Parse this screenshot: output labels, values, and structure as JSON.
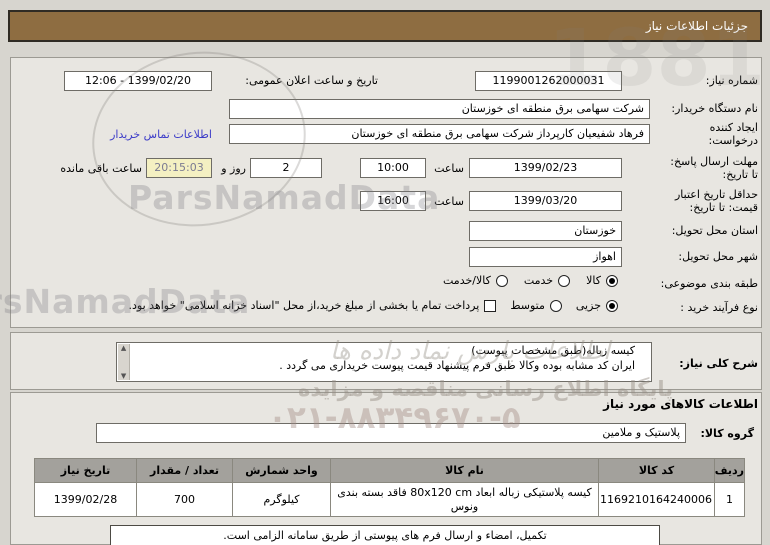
{
  "title_bar": {
    "title": "جزئیات اطلاعات نیاز"
  },
  "colors": {
    "title_bar_bg": "#8e6d41",
    "link": "#3c3cc8",
    "countdown_bg": "#f4f0c2",
    "table_header_bg": "#a3a19c"
  },
  "need_info": {
    "need_number_label": "شماره نیاز:",
    "need_number": "1199001262000031",
    "announce_label": "تاریخ و ساعت اعلان عمومی:",
    "announce_value": "1399/02/20 - 12:06",
    "buyer_label": "نام دستگاه خریدار:",
    "buyer_value": "شرکت سهامی برق منطقه ای خوزستان",
    "creator_label_line1": "ایجاد کننده",
    "creator_label_line2": "درخواست:",
    "creator_value": "فرهاد شفیعیان کارپرداز شرکت سهامی برق منطقه ای خوزستان",
    "contact_link": "اطلاعات تماس خریدار",
    "reply_deadline_label_line1": "مهلت ارسال پاسخ:",
    "reply_deadline_label_line2": "تا تاریخ:",
    "reply_deadline_date": "1399/02/23",
    "hour_label": "ساعت",
    "reply_deadline_time": "10:00",
    "remaining_days": "2",
    "days_and_label": "روز و",
    "remaining_time": "20:15:03",
    "remaining_suffix": "ساعت باقی مانده",
    "price_validity_label_line1": "حداقل تاریخ اعتبار",
    "price_validity_label_line2": "قیمت: تا تاریخ:",
    "price_validity_date": "1399/03/20",
    "price_validity_time": "16:00",
    "province_label": "استان محل تحویل:",
    "province_value": "خوزستان",
    "city_label": "شهر محل تحویل:",
    "city_value": "اهواز",
    "classification_label": "طبقه بندی موضوعی:",
    "classification_options": [
      {
        "label": "کالا",
        "selected": true
      },
      {
        "label": "خدمت",
        "selected": false
      },
      {
        "label": "کالا/خدمت",
        "selected": false
      }
    ],
    "process_label": "نوع فرآیند خرید :",
    "process_options": [
      {
        "label": "جزیی",
        "selected": true
      },
      {
        "label": "متوسط",
        "selected": false
      }
    ],
    "payment_checkbox_label": "پرداخت تمام یا بخشی از مبلغ خرید،از محل \"اسناد خزانه اسلامی\" خواهد بود.",
    "payment_checkbox_checked": false
  },
  "need_description": {
    "label": "شرح کلی نیاز:",
    "line1": "کیسه زباله(طبق مشخصات پیوست)",
    "line2": "ایران کد مشابه بوده وکالا طبق فرم پیشنهاد قیمت پیوست خریداری می گردد ."
  },
  "goods_section": {
    "header": "اطلاعات کالاهای مورد نیاز",
    "group_label": "گروه کالا:",
    "group_value": "پلاستیک و ملامین",
    "table": {
      "headers": [
        "ردیف",
        "کد کالا",
        "نام کالا",
        "واحد شمارش",
        "تعداد / مقدار",
        "تاریخ نیاز"
      ],
      "rows": [
        {
          "row_no": "1",
          "item_code": "1169210164240006",
          "item_name": "کیسه پلاستیکی زباله ابعاد 80x120 cm فاقد بسته بندی ونوس",
          "unit": "کیلوگرم",
          "quantity": "700",
          "need_date": "1399/02/28"
        }
      ]
    },
    "footer_note": "تکمیل، امضاء و ارسال فرم های پیوستی از طریق سامانه الزامی است."
  },
  "watermarks": {
    "latin": "ParsNamadData",
    "persian_line": "اطلاعات پارس نماد داده ها",
    "portal": "پایگاه اطلاع رسانی مناقصه و مزایده",
    "phone": "۰۲۱-۸۸۳۴۹۶۷۰-۵",
    "digits": "1881"
  }
}
